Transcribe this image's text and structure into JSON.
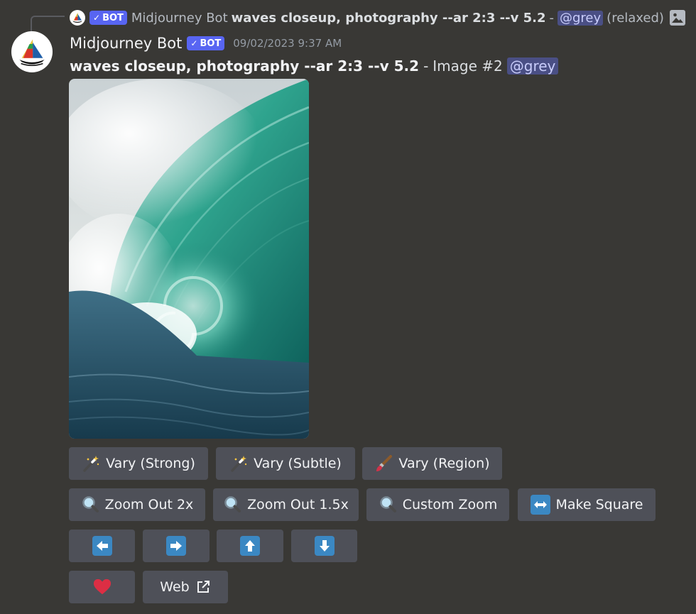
{
  "reply": {
    "author": "Midjourney Bot",
    "bot_label": "BOT",
    "prompt": "waves closeup, photography --ar 2:3 --v 5.2",
    "separator": "-",
    "mention": "@grey",
    "mode": "(relaxed)"
  },
  "message": {
    "author": "Midjourney Bot",
    "bot_label": "BOT",
    "timestamp": "09/02/2023 9:37 AM",
    "prompt": "waves closeup, photography --ar 2:3 --v 5.2",
    "separator": "-",
    "image_label": "Image #2",
    "mention": "@grey"
  },
  "buttons": {
    "vary_strong": "Vary (Strong)",
    "vary_subtle": "Vary (Subtle)",
    "vary_region": "Vary (Region)",
    "zoom_out_2x": "Zoom Out 2x",
    "zoom_out_1_5x": "Zoom Out 1.5x",
    "custom_zoom": "Custom Zoom",
    "make_square": "Make Square",
    "web": "Web"
  },
  "icons": {
    "vary": "magic-wand-icon",
    "region": "paintbrush-icon",
    "zoom": "magnifier-icon",
    "square": "left-right-arrow-icon",
    "pan": [
      "arrow-left-icon",
      "arrow-right-icon",
      "arrow-up-icon",
      "arrow-down-icon"
    ],
    "favorite": "heart-icon",
    "external": "external-link-icon"
  },
  "colors": {
    "background": "#393835",
    "button": "#4e5058",
    "bot_tag": "#5865f2",
    "mention_bg": "#4a4f85",
    "arrow_blue": "#3b88c3",
    "heart": "#dd2e44"
  }
}
